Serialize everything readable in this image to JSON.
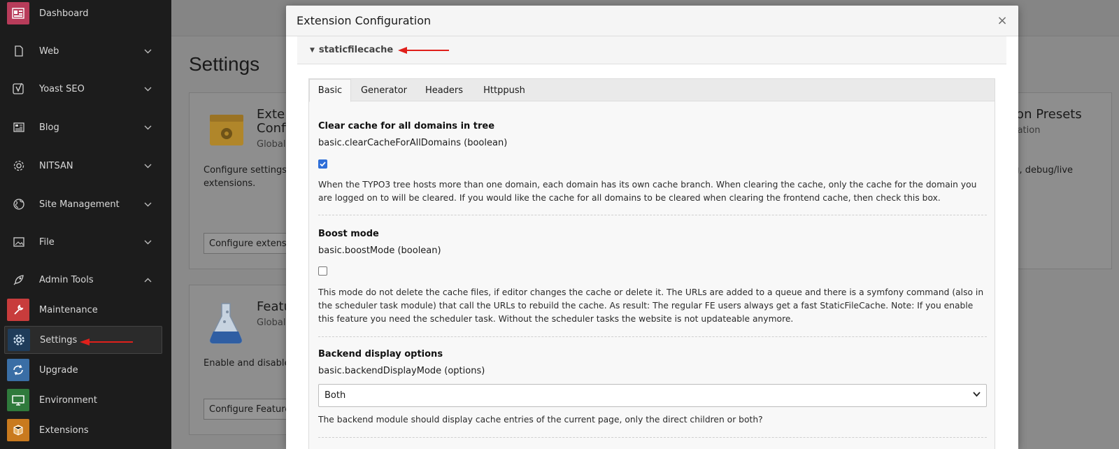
{
  "sidebar": {
    "items": [
      {
        "label": "Dashboard",
        "icon": "dashboard-icon"
      },
      {
        "label": "Web",
        "icon": "page-icon"
      },
      {
        "label": "Yoast SEO",
        "icon": "yoast-icon"
      },
      {
        "label": "Blog",
        "icon": "blog-icon"
      },
      {
        "label": "NITSAN",
        "icon": "gear-icon"
      },
      {
        "label": "Site Management",
        "icon": "globe-icon"
      },
      {
        "label": "File",
        "icon": "image-icon"
      },
      {
        "label": "Admin Tools",
        "icon": "rocket-icon"
      }
    ],
    "sub_items": [
      {
        "label": "Maintenance",
        "icon": "wrench-icon",
        "color": "#c83c3c"
      },
      {
        "label": "Settings",
        "icon": "gear-icon",
        "color": "#1f3c5a"
      },
      {
        "label": "Upgrade",
        "icon": "refresh-icon",
        "color": "#3a6ea5"
      },
      {
        "label": "Environment",
        "icon": "monitor-icon",
        "color": "#2f7a3c"
      },
      {
        "label": "Extensions",
        "icon": "box-icon",
        "color": "#c97a1e"
      }
    ],
    "dashboard_color": "#b83c5a"
  },
  "background": {
    "page_title": "Settings",
    "card1": {
      "title": "Exte",
      "title2": "Confi",
      "subtitle": "Global",
      "text1": "Configure settings",
      "text2": "extensions.",
      "button": "Configure extensi"
    },
    "card2": {
      "title": "Featu",
      "subtitle": "Global",
      "text": "Enable and disable",
      "button": "Configure Feature"
    },
    "card3": {
      "title": "tion Presets",
      "subtitle": "uration",
      "text": "ng, debug/live"
    }
  },
  "modal": {
    "title": "Extension Configuration",
    "close": "×",
    "extension": "staticfilecache",
    "tabs": [
      "Basic",
      "Generator",
      "Headers",
      "Httppush"
    ],
    "settings": [
      {
        "title": "Clear cache for all domains in tree",
        "key": "basic.clearCacheForAllDomains (boolean)",
        "checked": true,
        "desc": "When the TYPO3 tree hosts more than one domain, each domain has its own cache branch. When clearing the cache, only the cache for the domain you are logged on to will be cleared. If you would like the cache for all domains to be cleared when clearing the frontend cache, then check this box."
      },
      {
        "title": "Boost mode",
        "key": "basic.boostMode (boolean)",
        "checked": false,
        "desc": "This mode do not delete the cache files, if editor changes the cache or delete it. The URLs are added to a queue and there is a symfony command (also in the scheduler task module) that call the URLs to rebuild the cache. As result: The regular FE users always get a fast StaticFileCache. Note: If you enable this feature you need the scheduler task. Without the scheduler tasks the website is not updateable anymore."
      },
      {
        "title": "Backend display options",
        "key": "basic.backendDisplayMode (options)",
        "selected": "Both",
        "desc": "The backend module should display cache entries of the current page, only the direct children or both?"
      }
    ]
  },
  "colors": {
    "accent": "#2f6fd8",
    "annotation": "#e0201b"
  }
}
